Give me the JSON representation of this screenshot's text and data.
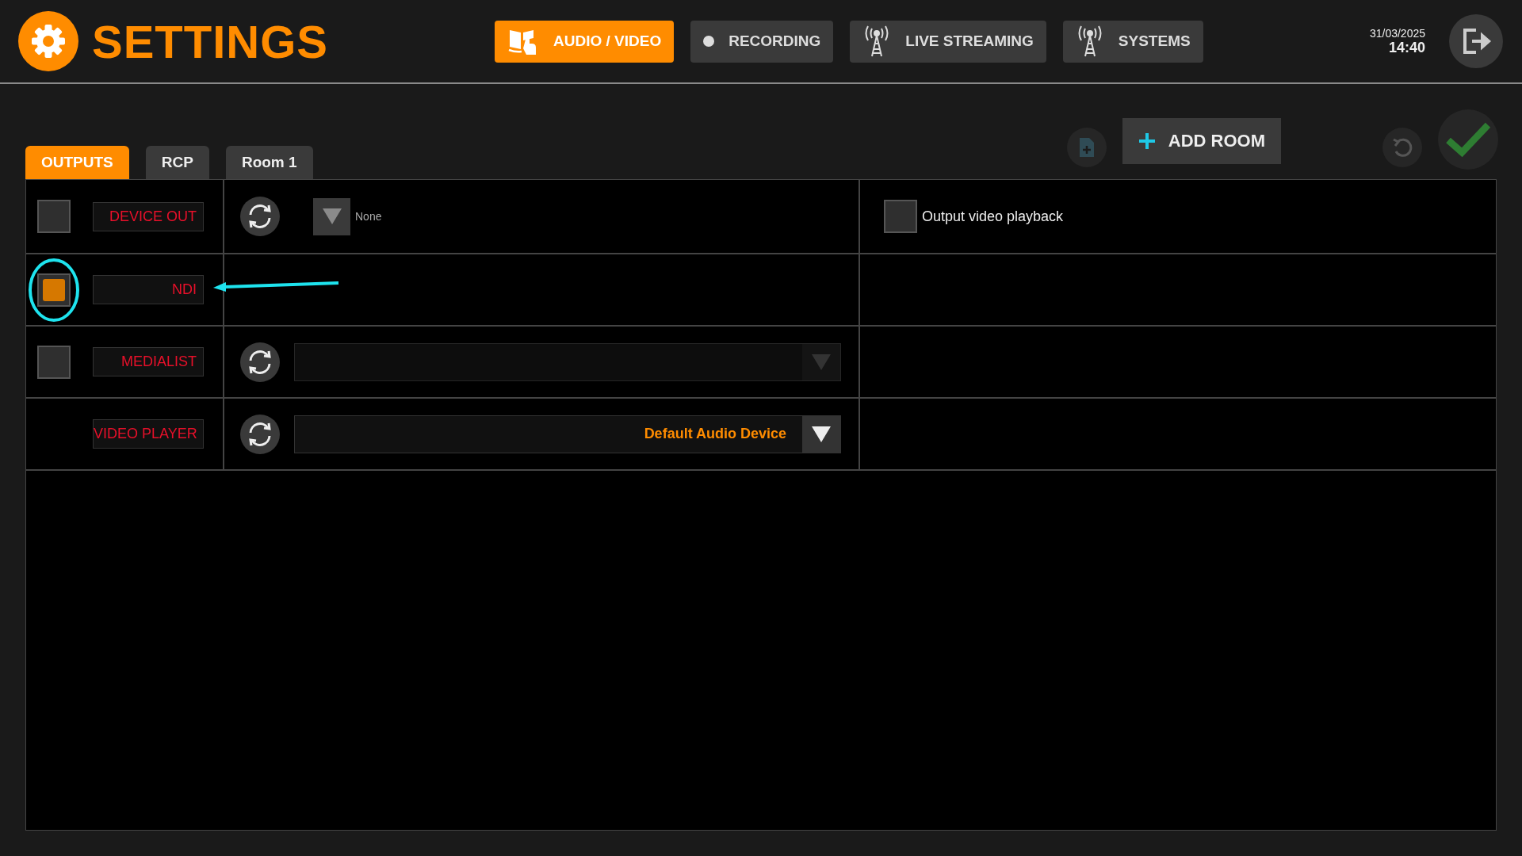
{
  "header": {
    "title": "SETTINGS",
    "nav": [
      {
        "label": "AUDIO / VIDEO",
        "selected": true
      },
      {
        "label": "RECORDING",
        "selected": false
      },
      {
        "label": "LIVE STREAMING",
        "selected": false
      },
      {
        "label": "SYSTEMS",
        "selected": false
      }
    ],
    "date": "31/03/2025",
    "time": "14:40"
  },
  "tabs": [
    {
      "label": "OUTPUTS",
      "selected": true
    },
    {
      "label": "RCP",
      "selected": false
    },
    {
      "label": "Room 1",
      "selected": false
    }
  ],
  "toolbar": {
    "add_room": "ADD ROOM"
  },
  "outputs": [
    {
      "label": "DEVICE OUT",
      "checkbox": true,
      "checked": false,
      "refresh": true,
      "highlighted": false,
      "dropdown": {
        "kind": "compact",
        "value": "None",
        "disabled": false
      },
      "option": {
        "label": "Output video playback",
        "checked": false
      }
    },
    {
      "label": "NDI",
      "checkbox": true,
      "checked": true,
      "refresh": false,
      "highlighted": true
    },
    {
      "label": "MEDIALIST",
      "checkbox": true,
      "checked": false,
      "refresh": true,
      "highlighted": false,
      "dropdown": {
        "kind": "wide",
        "disabled": true
      }
    },
    {
      "label": "VIDEO PLAYER",
      "checkbox": false,
      "refresh": true,
      "highlighted": false,
      "dropdown": {
        "kind": "wide",
        "value": "Default Audio Device",
        "disabled": false
      }
    }
  ]
}
